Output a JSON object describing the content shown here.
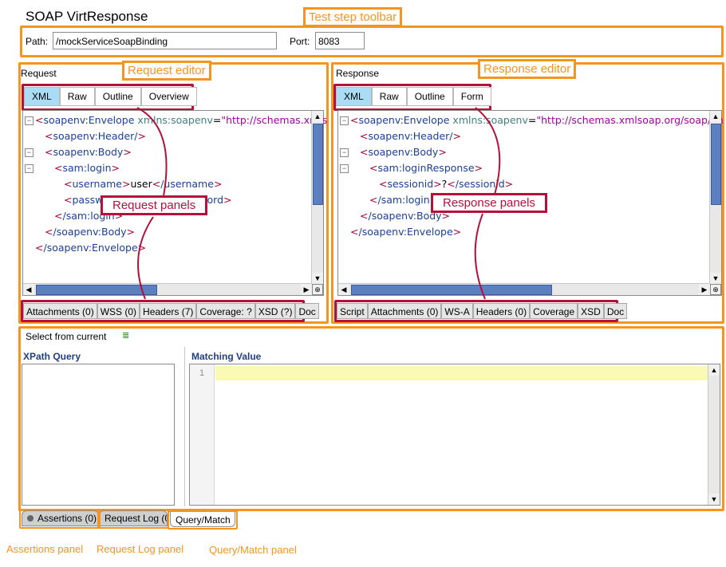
{
  "window": {
    "title": "SOAP VirtResponse"
  },
  "toolbar": {
    "path_label": "Path:",
    "path_value": "/mockServiceSoapBinding",
    "port_label": "Port:",
    "port_value": "8083"
  },
  "callouts": {
    "test_step_toolbar": "Test step toolbar",
    "request_editor": "Request editor",
    "response_editor": "Response editor",
    "request_panels": "Request panels",
    "response_panels": "Response panels"
  },
  "request": {
    "heading": "Request",
    "tabs": [
      "XML",
      "Raw",
      "Outline",
      "Overview"
    ],
    "active_tab": "XML",
    "xml": {
      "l1_tag": "soapenv:Envelope",
      "l1_attr": "xmlns:soapenv",
      "l1_val": "\"http://schemas.xmls",
      "l2_tag": "soapenv:Header/",
      "l3_tag": "soapenv:Body",
      "l4_tag": "sam:login",
      "l5_tag": "username",
      "l5_text": "user",
      "l5_close": "/username",
      "l6_tag": "passw",
      "l6_close": "word",
      "l7_tag": "/sam:login",
      "l8_tag": "/soapenv:Body",
      "l9_tag": "/soapenv:Envelope"
    },
    "panels": [
      "Attachments (0)",
      "WSS (0)",
      "Headers (7)",
      "Coverage: ?",
      "XSD (?)",
      "Doc"
    ]
  },
  "response": {
    "heading": "Response",
    "tabs": [
      "XML",
      "Raw",
      "Outline",
      "Form"
    ],
    "active_tab": "XML",
    "xml": {
      "l1_tag": "soapenv:Envelope",
      "l1_attr": "xmlns:soapenv",
      "l1_val": "\"http://schemas.xmlsoap.org/soap/en",
      "l2_tag": "soapenv:Header/",
      "l3_tag": "soapenv:Body",
      "l4_tag": "sam:loginResponse",
      "l5_tag": "sessionid",
      "l5_text": "?",
      "l5_close": "/sessionid",
      "l6_tag": "/sam:loginR",
      "l7_tag": "/soapenv:Body",
      "l8_tag": "/soapenv:Envelope"
    },
    "panels": [
      "Script",
      "Attachments (0)",
      "WS-A",
      "Headers (0)",
      "Coverage",
      "XSD",
      "Doc"
    ]
  },
  "query": {
    "select_label": "Select from current",
    "xpath_heading": "XPath Query",
    "value_heading": "Matching Value",
    "line_number": "1"
  },
  "bottom_tabs": [
    "Assertions (0)",
    "Request Log (0)",
    "Query/Match"
  ],
  "bottom_labels": [
    "Assertions panel",
    "Request Log panel",
    "Query/Match panel"
  ],
  "colors": {
    "accent_orange": "#f7941d",
    "accent_red": "#b5103a",
    "active_tab": "#aadcf5"
  }
}
